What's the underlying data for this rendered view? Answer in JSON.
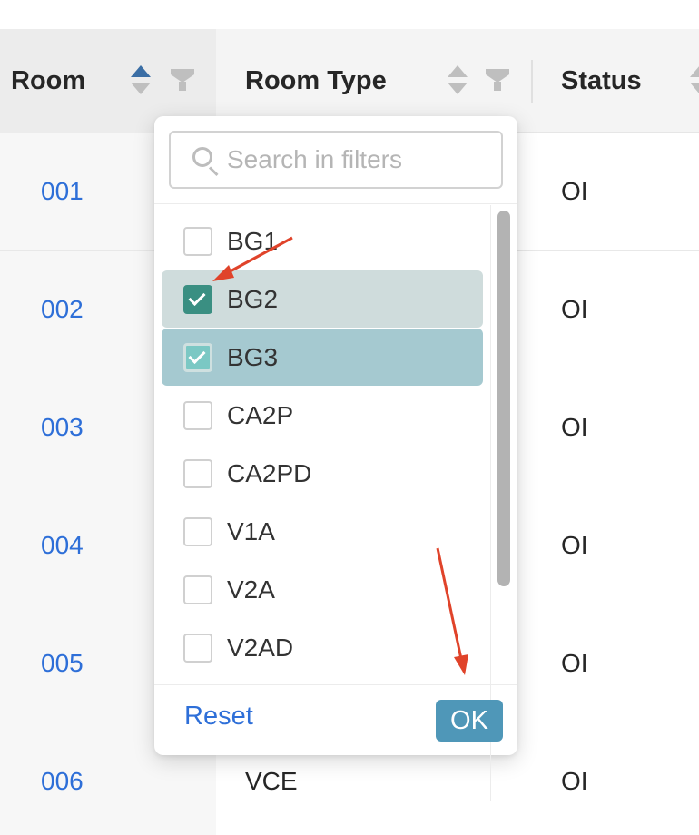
{
  "table": {
    "columns": [
      {
        "label": "Room"
      },
      {
        "label": "Room Type"
      },
      {
        "label": "Status"
      }
    ],
    "rows": [
      {
        "room": "001",
        "type": "",
        "status": "OI"
      },
      {
        "room": "002",
        "type": "",
        "status": "OI"
      },
      {
        "room": "003",
        "type": "",
        "status": "OI"
      },
      {
        "room": "004",
        "type": "",
        "status": "OI"
      },
      {
        "room": "005",
        "type": "",
        "status": "OI"
      },
      {
        "room": "006",
        "type": "VCE",
        "status": "OI"
      }
    ]
  },
  "filter": {
    "search_placeholder": "Search in filters",
    "options": [
      {
        "label": "BG1",
        "checked": false
      },
      {
        "label": "BG2",
        "checked": true
      },
      {
        "label": "BG3",
        "checked": true
      },
      {
        "label": "CA2P",
        "checked": false
      },
      {
        "label": "CA2PD",
        "checked": false
      },
      {
        "label": "V1A",
        "checked": false
      },
      {
        "label": "V2A",
        "checked": false
      },
      {
        "label": "V2AD",
        "checked": false
      }
    ],
    "reset_label": "Reset",
    "ok_label": "OK"
  },
  "colors": {
    "link": "#2e6fd8",
    "checkbox_checked": "#3a8f82",
    "selected_row": "#cfdcdc",
    "hover_row": "#a5c9d0",
    "ok_button": "#4f97b8",
    "annotation_arrow": "#e0432a"
  }
}
